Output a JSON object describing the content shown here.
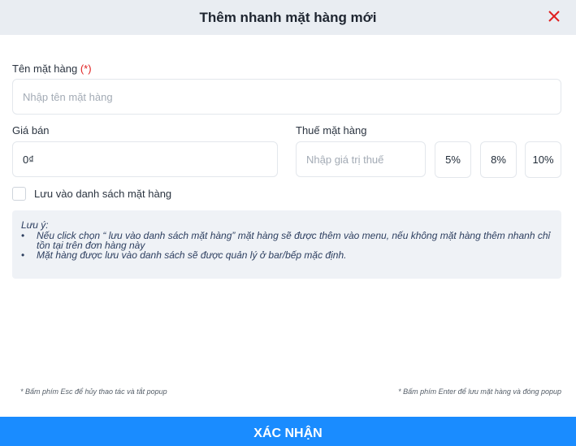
{
  "dialog": {
    "title": "Thêm nhanh mặt hàng mới",
    "close_icon": "close-x-icon",
    "close_color": "#e02020"
  },
  "form": {
    "name_label": "Tên mặt hàng",
    "required_mark": "(*)",
    "name_placeholder": "Nhập tên mặt hàng",
    "name_value": "",
    "price_label": "Giá bán",
    "price_value": "0₫",
    "tax_label": "Thuế mặt hàng",
    "tax_placeholder": "Nhập giá trị thuế",
    "tax_value": "",
    "tax_options": [
      "5%",
      "8%",
      "10%"
    ],
    "save_to_list_label": "Lưu vào danh sách mặt hàng",
    "save_to_list_checked": false
  },
  "note": {
    "title": "Lưu ý:",
    "items": [
      "Nếu click chọn “ lưu vào danh sách mặt hàng” mặt hàng sẽ được thêm vào menu, nếu không mặt hàng thêm nhanh chỉ tồn tại trên đơn hàng này",
      "Mặt hàng được lưu vào danh sách sẽ được quản lý ở bar/bếp mặc định."
    ],
    "bullet": "•"
  },
  "footer": {
    "hint_esc": "* Bấm phím Esc để hủy thao tác và tắt popup",
    "hint_enter": "* Bấm phím Enter để lưu mặt hàng và đóng popup",
    "confirm_label": "XÁC NHẬN",
    "confirm_color": "#1a8cff"
  }
}
